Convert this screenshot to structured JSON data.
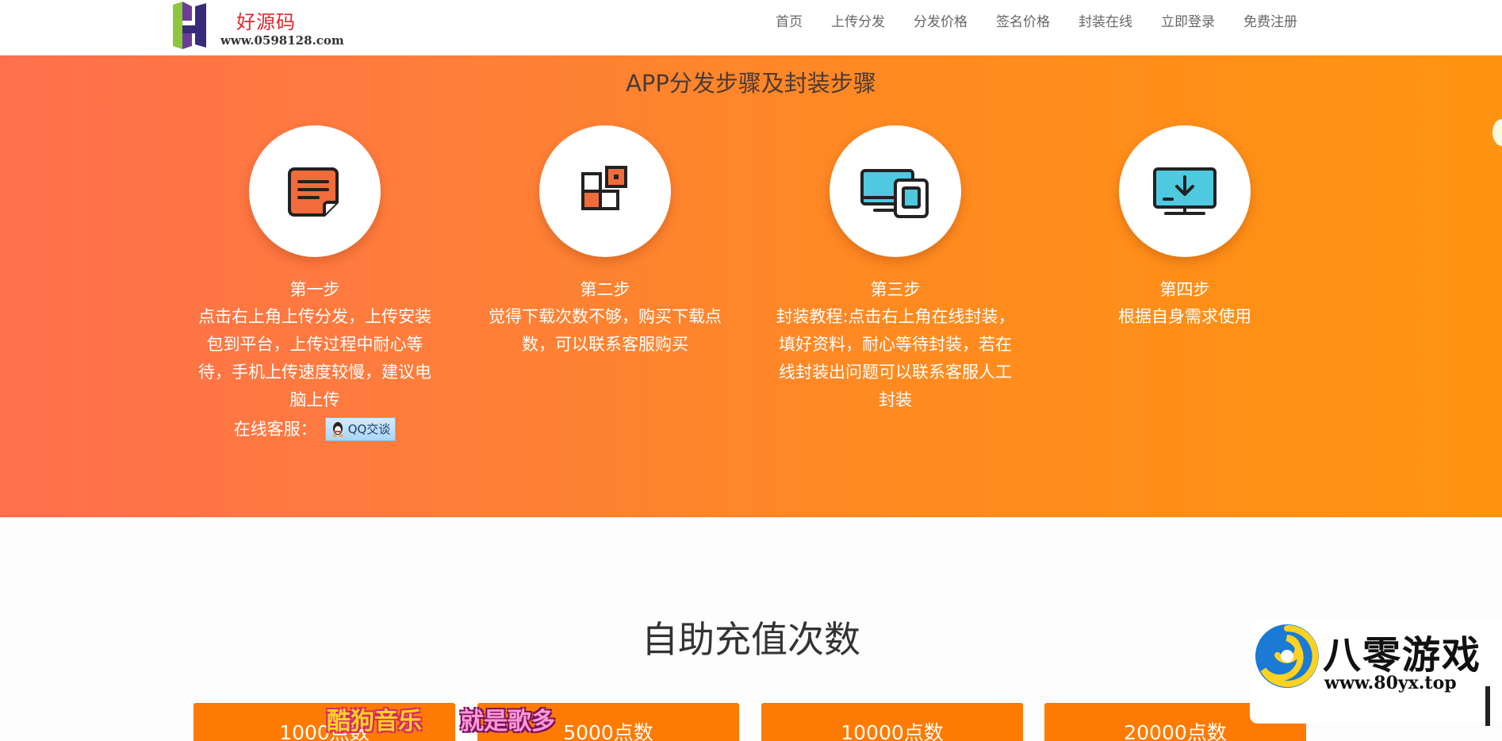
{
  "header": {
    "logo_cn": "好源码",
    "logo_url": "www.0598128.com",
    "nav": [
      {
        "label": "首页"
      },
      {
        "label": "上传分发"
      },
      {
        "label": "分发价格"
      },
      {
        "label": "签名价格"
      },
      {
        "label": "封装在线"
      },
      {
        "label": "立即登录"
      },
      {
        "label": "免费注册"
      }
    ]
  },
  "hero": {
    "title": "APP分发步骤及封装步骤",
    "steps": [
      {
        "name": "第一步",
        "desc": "点击右上角上传分发，上传安装包到平台，上传过程中耐心等待，手机上传速度较慢，建议电脑上传",
        "icon": "document-icon"
      },
      {
        "name": "第二步",
        "desc": "觉得下载次数不够，购买下载点数，可以联系客服购买",
        "icon": "apps-grid-icon"
      },
      {
        "name": "第三步",
        "desc": "封装教程:点击右上角在线封装，填好资料，耐心等待封装，若在线封装出问题可以联系客服人工封装",
        "icon": "devices-icon"
      },
      {
        "name": "第四步",
        "desc": "根据自身需求使用",
        "icon": "monitor-download-icon"
      }
    ],
    "service_label": "在线客服：",
    "qq_button": "QQ交谈"
  },
  "recharge": {
    "title": "自助充值次数",
    "packages": [
      {
        "label": "1000点数"
      },
      {
        "label": "5000点数"
      },
      {
        "label": "10000点数"
      },
      {
        "label": "20000点数"
      }
    ]
  },
  "overlay": {
    "brand_cn": "八零游戏",
    "brand_url": "www.80yx.top",
    "lyric_left": "酷狗音乐",
    "lyric_right": "就是歌多"
  },
  "colors": {
    "hero_start": "#ff6f4d",
    "hero_end": "#ff9410",
    "package_bg": "#ff7a00",
    "logo_red": "#e0262d"
  }
}
